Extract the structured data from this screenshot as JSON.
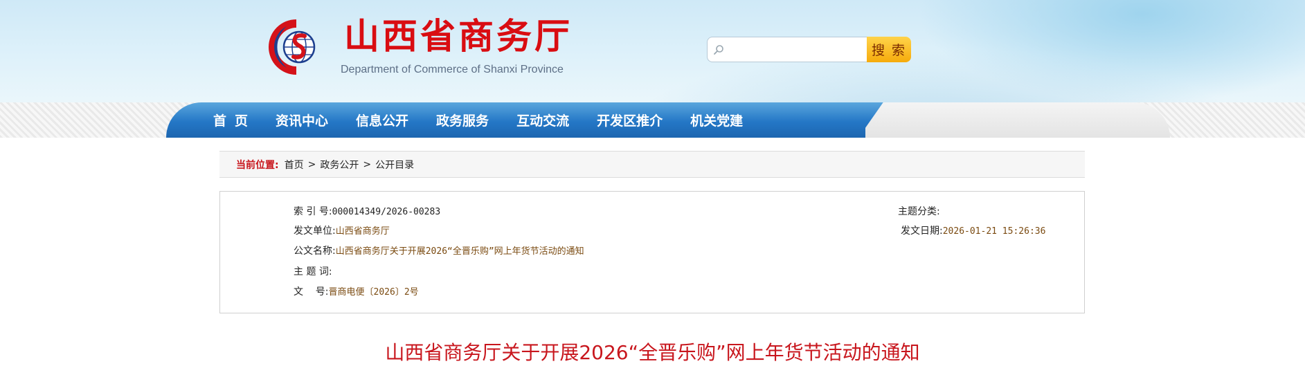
{
  "header": {
    "title": "山西省商务厅",
    "subtitle": "Department of Commerce of Shanxi Province",
    "search": {
      "placeholder": "",
      "value": "",
      "button_label": "搜 索"
    }
  },
  "nav": {
    "items": [
      "首页",
      "资讯中心",
      "信息公开",
      "政务服务",
      "互动交流",
      "开发区推介",
      "机关党建"
    ]
  },
  "breadcrumb": {
    "label": "当前位置:",
    "items": [
      "首页",
      "政务公开",
      "公开目录"
    ],
    "separator": ">"
  },
  "info": {
    "index_label": "索 引 号:",
    "index_value": "000014349/2026-00283",
    "topic_label": "主题分类:",
    "topic_value": "",
    "issuer_label": "发文单位:",
    "issuer_value": "山西省商务厅",
    "date_label": "发文日期:",
    "date_value": "2026-01-21 15:26:36",
    "name_label": "公文名称:",
    "name_value": "山西省商务厅关于开展2026“全晋乐购”网上年货节活动的通知",
    "keywords_label": "主 题 词:",
    "keywords_value": "",
    "docno_label": "文    号:",
    "docno_value": "晋商电便〔2026〕2号"
  },
  "article": {
    "title": "山西省商务厅关于开展2026“全晋乐购”网上年货节活动的通知"
  },
  "colors": {
    "brand_red": "#d90d12",
    "nav_blue": "#2477c6",
    "search_button": "#f6ab0c"
  }
}
